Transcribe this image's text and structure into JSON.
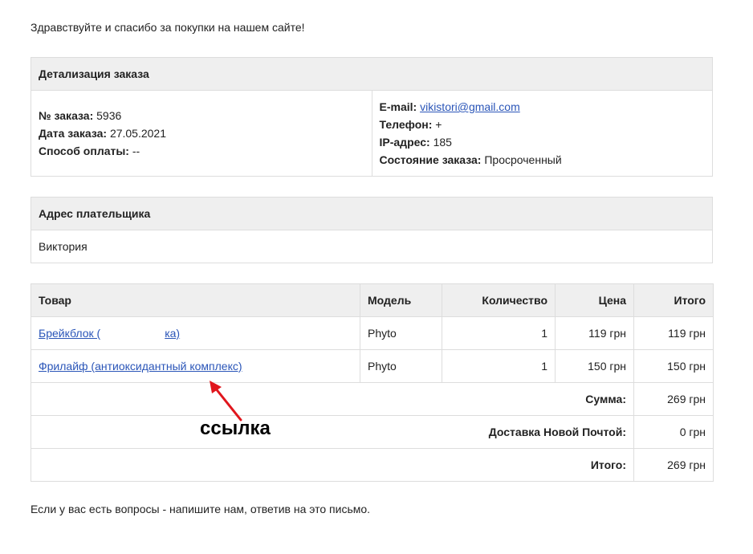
{
  "greeting": "Здравствуйте и спасибо за покупки на нашем сайте!",
  "order_details": {
    "header": "Детализация заказа",
    "order_no_label": "№ заказа:",
    "order_no": "5936",
    "date_label": "Дата заказа:",
    "date": "27.05.2021",
    "payment_label": "Способ оплаты:",
    "payment": "--",
    "email_label": "E-mail:",
    "email": "vikistori@gmail.com",
    "phone_label": "Телефон:",
    "phone": "+",
    "ip_label": "IP-адрес:",
    "ip": "185",
    "status_label": "Состояние заказа:",
    "status": "Просроченный"
  },
  "payer": {
    "header": "Адрес плательщика",
    "name": "Виктория"
  },
  "products": {
    "headers": {
      "product": "Товар",
      "model": "Модель",
      "quantity": "Количество",
      "price": "Цена",
      "total": "Итого"
    },
    "rows": [
      {
        "name_start": "Брейкблок (",
        "name_end": "ка)",
        "model": "Phyto",
        "quantity": "1",
        "price": "119 грн",
        "total": "119 грн"
      },
      {
        "name": "Фрилайф (антиоксидантный комплекс)",
        "model": "Phyto",
        "quantity": "1",
        "price": "150 грн",
        "total": "150 грн"
      }
    ],
    "summary": [
      {
        "label": "Сумма:",
        "value": "269 грн"
      },
      {
        "label": "Доставка Новой Почтой:",
        "value": "0 грн"
      },
      {
        "label": "Итого:",
        "value": "269 грн"
      }
    ]
  },
  "annotation": {
    "text": "ссылка",
    "arrow_color": "#e0161d"
  },
  "footer": "Если у вас есть вопросы - напишите нам, ответив на это письмо."
}
